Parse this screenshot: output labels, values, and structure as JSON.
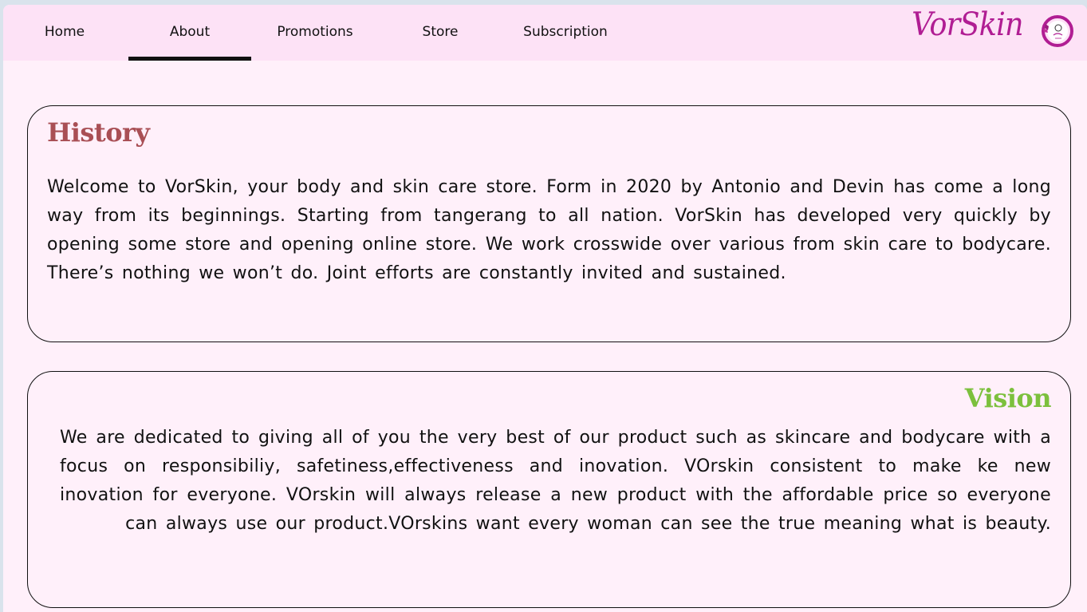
{
  "nav": {
    "items": [
      {
        "label": "Home",
        "active": false
      },
      {
        "label": "About",
        "active": true
      },
      {
        "label": "Promotions",
        "active": false
      },
      {
        "label": "Store",
        "active": false
      },
      {
        "label": "Subscription",
        "active": false
      }
    ],
    "brand": "VorSkin",
    "logo_icon": "vorskin-logo-icon"
  },
  "history": {
    "title": "History",
    "text": "Welcome to VorSkin, your body and skin care store. Form in 2020 by Antonio and Devin has come a long way from its beginnings. Starting from tangerang to all nation. VorSkin has developed very quickly by opening some store and opening online store. We work crosswide over various from skin care to bodycare. There’s nothing we won’t do. Joint efforts are constantly invited and sustained."
  },
  "vision": {
    "title": "Vision",
    "text": "We are dedicated to giving all of you the very best of our product such as skincare and bodycare with a focus on responsibiliy, safetiness,effectiveness and inovation. VOrskin consistent to make ke new inovation for everyone. VOrskin will always release a new product with the affordable price so everyone can always use our product.VOrskins want every woman can see the true meaning what is beauty."
  },
  "colors": {
    "page_bg": "#fff0fa",
    "navbar_bg": "#fde2f6",
    "brand": "#b01d93",
    "history_title": "#a94f55",
    "vision_title": "#7cc03d"
  }
}
